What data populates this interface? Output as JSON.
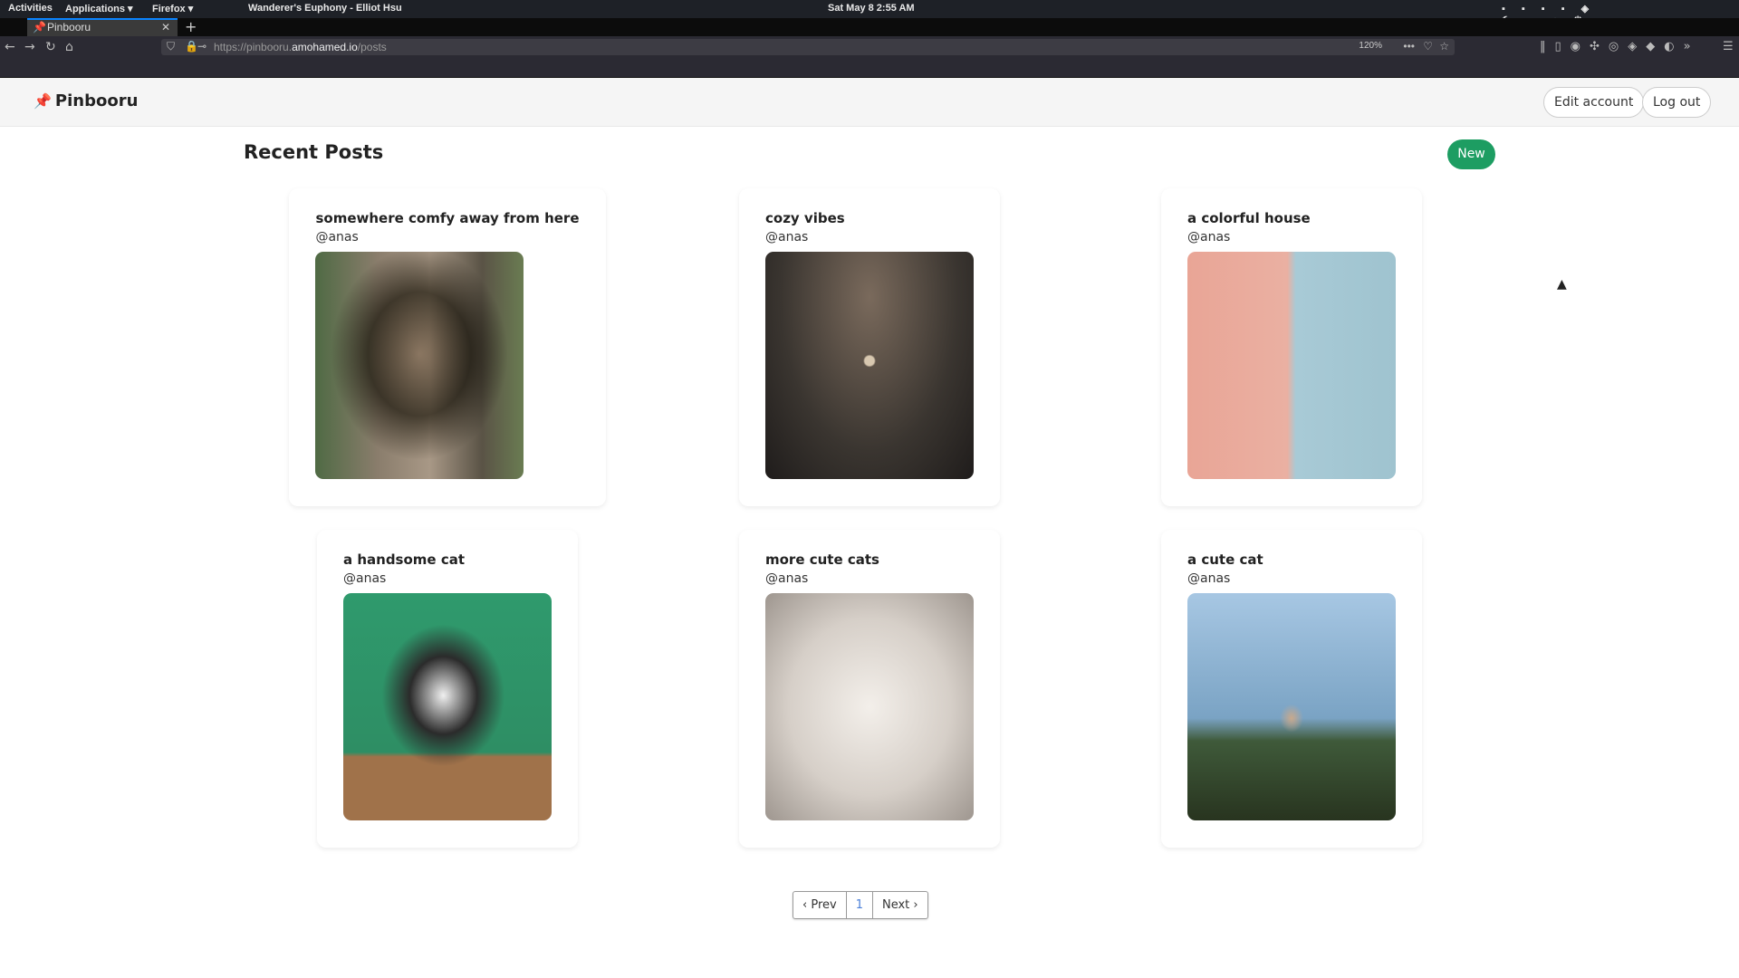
{
  "system": {
    "activities": "Activities",
    "applications": "Applications ▾",
    "firefox": "Firefox ▾",
    "now_playing": "Wanderer's Euphony - Elliot Hsu",
    "datetime": "Sat May 8   2:55 AM"
  },
  "browser": {
    "tab_title": "Pinbooru",
    "url_prefix": "https://pinbooru.",
    "url_domain": "amohamed.io",
    "url_path": "/posts",
    "zoom": "120%"
  },
  "header": {
    "brand": "Pinbooru",
    "edit_account": "Edit account",
    "log_out": "Log out"
  },
  "main": {
    "title": "Recent Posts",
    "new_label": "New"
  },
  "posts": [
    {
      "title": "somewhere comfy away from here",
      "author": "@anas"
    },
    {
      "title": "cozy vibes",
      "author": "@anas"
    },
    {
      "title": "a colorful house",
      "author": "@anas"
    },
    {
      "title": "a handsome cat",
      "author": "@anas"
    },
    {
      "title": "more cute cats",
      "author": "@anas"
    },
    {
      "title": "a cute cat",
      "author": "@anas"
    }
  ],
  "pagination": {
    "prev": "‹ Prev",
    "current": "1",
    "next": "Next ›"
  },
  "colors": {
    "accent": "#1d9d62",
    "brand_pin": "#e0342f"
  }
}
